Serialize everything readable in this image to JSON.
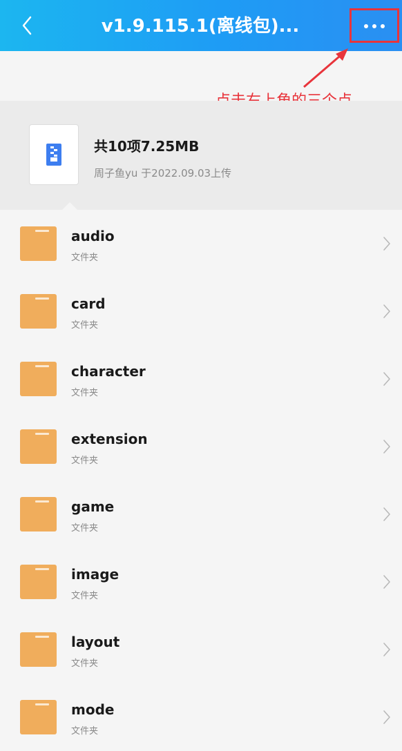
{
  "header": {
    "title": "v1.9.115.1(离线包)...",
    "accent": "#1e9cf5"
  },
  "annotation": {
    "text": "点击右上角的三个点",
    "color": "#e8343b"
  },
  "summary": {
    "title": "共10项7.25MB",
    "subtitle": "周子鱼yu 于2022.09.03上传"
  },
  "files": [
    {
      "name": "audio",
      "type": "文件夹"
    },
    {
      "name": "card",
      "type": "文件夹"
    },
    {
      "name": "character",
      "type": "文件夹"
    },
    {
      "name": "extension",
      "type": "文件夹"
    },
    {
      "name": "game",
      "type": "文件夹"
    },
    {
      "name": "image",
      "type": "文件夹"
    },
    {
      "name": "layout",
      "type": "文件夹"
    },
    {
      "name": "mode",
      "type": "文件夹"
    }
  ],
  "icons": {
    "back": "chevron-left-icon",
    "more": "more-horizontal-icon",
    "folder": "folder-icon",
    "archive": "zip-archive-icon",
    "row_arrow": "chevron-right-icon"
  }
}
